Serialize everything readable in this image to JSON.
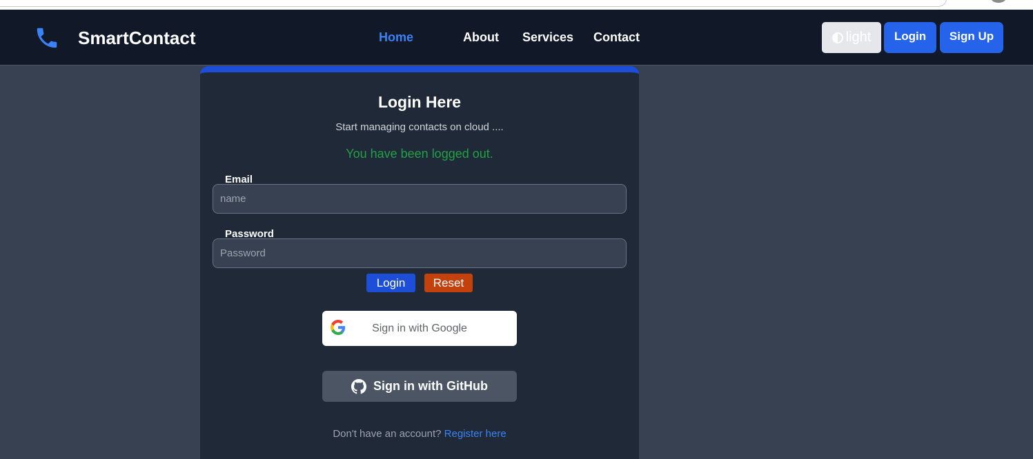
{
  "brand": {
    "name": "SmartContact",
    "icon": "phone-icon"
  },
  "nav": {
    "links": [
      {
        "label": "Home",
        "active": true
      },
      {
        "label": "About"
      },
      {
        "label": "Services"
      },
      {
        "label": "Contact"
      }
    ],
    "theme_label": "light",
    "login_label": "Login",
    "signup_label": "Sign Up"
  },
  "card": {
    "title": "Login Here",
    "subtitle": "Start managing contacts on cloud ....",
    "message": "You have been logged out.",
    "email_label": "Email",
    "email_placeholder": "name",
    "password_label": "Password",
    "password_placeholder": "Password",
    "login_button": "Login",
    "reset_button": "Reset",
    "google_button": "Sign in with Google",
    "github_button": "Sign in with GitHub",
    "register_prompt": "Don't have an account?",
    "register_link": "Register here"
  },
  "colors": {
    "accent": "#2563eb",
    "success": "#22a046",
    "reset": "#c2410c",
    "navbar": "#111827",
    "card": "#1f2937",
    "page": "#374151"
  }
}
